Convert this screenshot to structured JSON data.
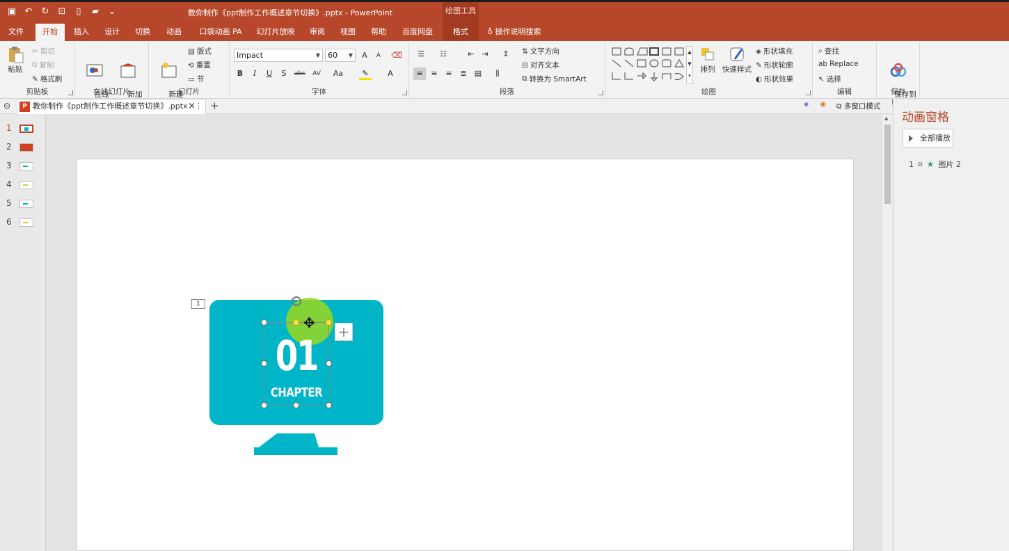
{
  "title_bar": {
    "doc_title": "教你制作《ppt制作工作概述章节切换》.pptx - PowerPoint",
    "context_tools": "绘图工具"
  },
  "tabs": [
    "文件",
    "开始",
    "插入",
    "设计",
    "切换",
    "动画",
    "口袋动画 PA",
    "幻灯片放映",
    "审阅",
    "视图",
    "帮助",
    "百度网盘",
    "格式"
  ],
  "tell_me": "操作说明搜索",
  "ribbon": {
    "clipboard": {
      "paste": "粘贴",
      "cut": "剪切",
      "copy": "复制",
      "format_painter": "格式刷",
      "label": "剪贴板"
    },
    "online_slides": {
      "online": "在线\n幻灯片",
      "new_anim": "新加\n动画页",
      "label": "在线幻灯片"
    },
    "slides": {
      "new_slide": "新建\n幻灯片",
      "layout": "版式",
      "reset": "重置",
      "section": "节",
      "label": "幻灯片"
    },
    "font": {
      "font_name": "Impact",
      "font_size": "60",
      "label": "字体",
      "bold": "B",
      "italic": "I",
      "underline": "U",
      "shadow": "S",
      "strike": "abc",
      "spacing": "AV",
      "case": "Aa",
      "grow": "A",
      "shrink": "A"
    },
    "paragraph": {
      "text_direction": "文字方向",
      "align_text": "对齐文本",
      "smartart": "转换为 SmartArt",
      "label": "段落"
    },
    "drawing": {
      "arrange": "排列",
      "quick_styles": "快速样式",
      "shape_fill": "形状填充",
      "shape_outline": "形状轮廓",
      "shape_effects": "形状效果",
      "label": "绘图"
    },
    "editing": {
      "find": "查找",
      "replace": "Replace",
      "select": "选择",
      "label": "编辑"
    },
    "save": {
      "save_to_baidu": "保存到\n百度网盘",
      "label": "保存"
    }
  },
  "doc_tab": {
    "name": "教你制作《ppt制作工作概述章节切换》.pptx",
    "close": "×",
    "add": "+",
    "multiwindow": "多窗口模式"
  },
  "slides": [
    {
      "num": "1",
      "selected": true
    },
    {
      "num": "2",
      "selected": false
    },
    {
      "num": "3",
      "selected": false
    },
    {
      "num": "4",
      "selected": false
    },
    {
      "num": "5",
      "selected": false
    },
    {
      "num": "6",
      "selected": false
    }
  ],
  "slide_content": {
    "anim_tag": "1",
    "number": "01",
    "chapter": "CHAPTER",
    "plus": "+"
  },
  "anim_pane": {
    "title": "动画窗格",
    "play_all": "全部播放",
    "item_num": "1",
    "item_name": "图片 2"
  },
  "colors": {
    "accent": "#b7472a",
    "monitor": "#00b5c8",
    "highlight": "#9ad81e"
  }
}
